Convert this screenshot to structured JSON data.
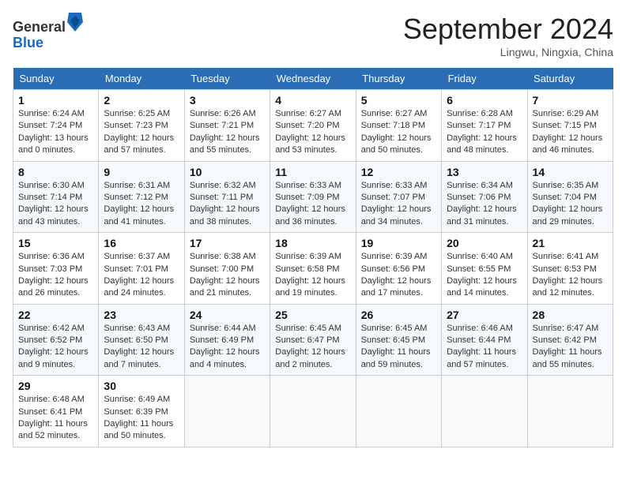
{
  "header": {
    "logo_line1": "General",
    "logo_line2": "Blue",
    "month_title": "September 2024",
    "location": "Lingwu, Ningxia, China"
  },
  "days_of_week": [
    "Sunday",
    "Monday",
    "Tuesday",
    "Wednesday",
    "Thursday",
    "Friday",
    "Saturday"
  ],
  "weeks": [
    [
      {
        "day": "1",
        "sunrise": "6:24 AM",
        "sunset": "7:24 PM",
        "daylight": "13 hours and 0 minutes."
      },
      {
        "day": "2",
        "sunrise": "6:25 AM",
        "sunset": "7:23 PM",
        "daylight": "12 hours and 57 minutes."
      },
      {
        "day": "3",
        "sunrise": "6:26 AM",
        "sunset": "7:21 PM",
        "daylight": "12 hours and 55 minutes."
      },
      {
        "day": "4",
        "sunrise": "6:27 AM",
        "sunset": "7:20 PM",
        "daylight": "12 hours and 53 minutes."
      },
      {
        "day": "5",
        "sunrise": "6:27 AM",
        "sunset": "7:18 PM",
        "daylight": "12 hours and 50 minutes."
      },
      {
        "day": "6",
        "sunrise": "6:28 AM",
        "sunset": "7:17 PM",
        "daylight": "12 hours and 48 minutes."
      },
      {
        "day": "7",
        "sunrise": "6:29 AM",
        "sunset": "7:15 PM",
        "daylight": "12 hours and 46 minutes."
      }
    ],
    [
      {
        "day": "8",
        "sunrise": "6:30 AM",
        "sunset": "7:14 PM",
        "daylight": "12 hours and 43 minutes."
      },
      {
        "day": "9",
        "sunrise": "6:31 AM",
        "sunset": "7:12 PM",
        "daylight": "12 hours and 41 minutes."
      },
      {
        "day": "10",
        "sunrise": "6:32 AM",
        "sunset": "7:11 PM",
        "daylight": "12 hours and 38 minutes."
      },
      {
        "day": "11",
        "sunrise": "6:33 AM",
        "sunset": "7:09 PM",
        "daylight": "12 hours and 36 minutes."
      },
      {
        "day": "12",
        "sunrise": "6:33 AM",
        "sunset": "7:07 PM",
        "daylight": "12 hours and 34 minutes."
      },
      {
        "day": "13",
        "sunrise": "6:34 AM",
        "sunset": "7:06 PM",
        "daylight": "12 hours and 31 minutes."
      },
      {
        "day": "14",
        "sunrise": "6:35 AM",
        "sunset": "7:04 PM",
        "daylight": "12 hours and 29 minutes."
      }
    ],
    [
      {
        "day": "15",
        "sunrise": "6:36 AM",
        "sunset": "7:03 PM",
        "daylight": "12 hours and 26 minutes."
      },
      {
        "day": "16",
        "sunrise": "6:37 AM",
        "sunset": "7:01 PM",
        "daylight": "12 hours and 24 minutes."
      },
      {
        "day": "17",
        "sunrise": "6:38 AM",
        "sunset": "7:00 PM",
        "daylight": "12 hours and 21 minutes."
      },
      {
        "day": "18",
        "sunrise": "6:39 AM",
        "sunset": "6:58 PM",
        "daylight": "12 hours and 19 minutes."
      },
      {
        "day": "19",
        "sunrise": "6:39 AM",
        "sunset": "6:56 PM",
        "daylight": "12 hours and 17 minutes."
      },
      {
        "day": "20",
        "sunrise": "6:40 AM",
        "sunset": "6:55 PM",
        "daylight": "12 hours and 14 minutes."
      },
      {
        "day": "21",
        "sunrise": "6:41 AM",
        "sunset": "6:53 PM",
        "daylight": "12 hours and 12 minutes."
      }
    ],
    [
      {
        "day": "22",
        "sunrise": "6:42 AM",
        "sunset": "6:52 PM",
        "daylight": "12 hours and 9 minutes."
      },
      {
        "day": "23",
        "sunrise": "6:43 AM",
        "sunset": "6:50 PM",
        "daylight": "12 hours and 7 minutes."
      },
      {
        "day": "24",
        "sunrise": "6:44 AM",
        "sunset": "6:49 PM",
        "daylight": "12 hours and 4 minutes."
      },
      {
        "day": "25",
        "sunrise": "6:45 AM",
        "sunset": "6:47 PM",
        "daylight": "12 hours and 2 minutes."
      },
      {
        "day": "26",
        "sunrise": "6:45 AM",
        "sunset": "6:45 PM",
        "daylight": "11 hours and 59 minutes."
      },
      {
        "day": "27",
        "sunrise": "6:46 AM",
        "sunset": "6:44 PM",
        "daylight": "11 hours and 57 minutes."
      },
      {
        "day": "28",
        "sunrise": "6:47 AM",
        "sunset": "6:42 PM",
        "daylight": "11 hours and 55 minutes."
      }
    ],
    [
      {
        "day": "29",
        "sunrise": "6:48 AM",
        "sunset": "6:41 PM",
        "daylight": "11 hours and 52 minutes."
      },
      {
        "day": "30",
        "sunrise": "6:49 AM",
        "sunset": "6:39 PM",
        "daylight": "11 hours and 50 minutes."
      },
      null,
      null,
      null,
      null,
      null
    ]
  ]
}
